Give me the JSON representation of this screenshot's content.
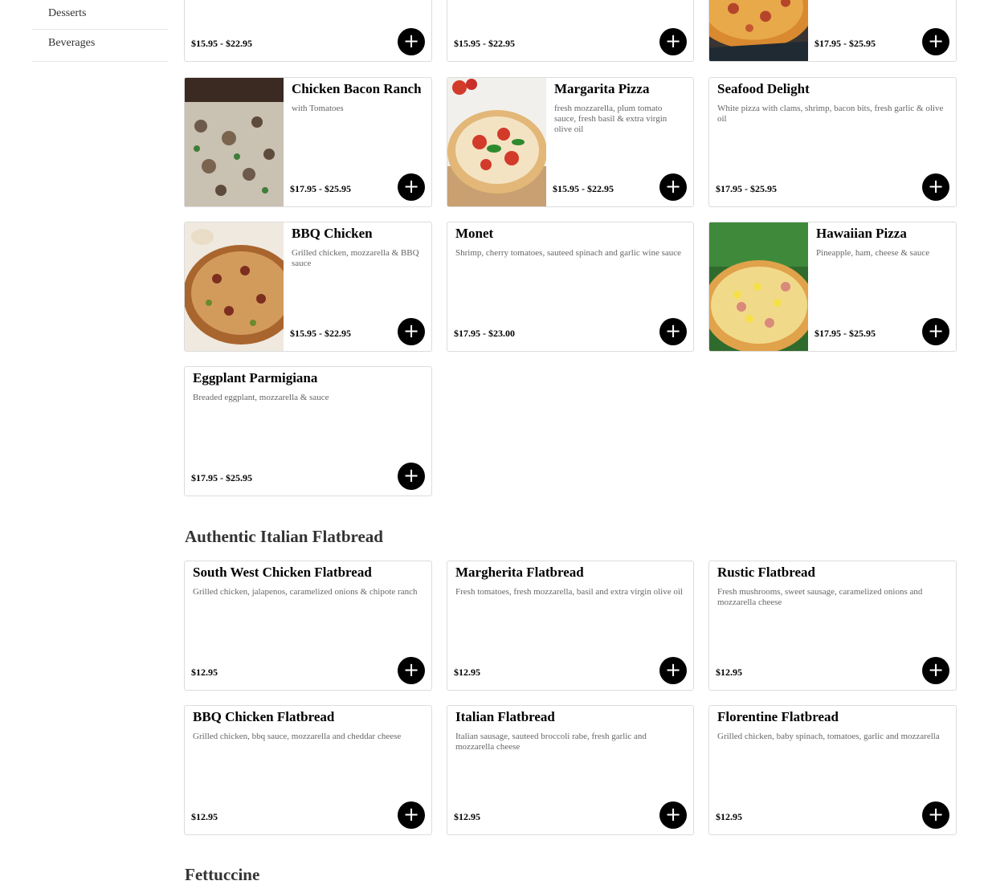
{
  "sidebar": {
    "items": [
      {
        "label": "Desserts"
      },
      {
        "label": "Beverages"
      }
    ]
  },
  "add_icon": "plus-icon",
  "pizza_partial": [
    {
      "price": "$15.95 - $22.95"
    },
    {
      "price": "$15.95 - $22.95"
    },
    {
      "price": "$17.95 - $25.95"
    }
  ],
  "pizza": [
    {
      "title": "Chicken Bacon Ranch",
      "desc": "with Tomatoes",
      "price": "$17.95 - $25.95"
    },
    {
      "title": "Margarita Pizza",
      "desc": "fresh mozzarella, plum tomato sauce, fresh basil & extra virgin olive oil",
      "price": "$15.95 - $22.95"
    },
    {
      "title": "Seafood Delight",
      "desc": "White pizza with clams, shrimp, bacon bits, fresh garlic & olive oil",
      "price": "$17.95 - $25.95"
    },
    {
      "title": "BBQ Chicken",
      "desc": "Grilled chicken, mozzarella & BBQ sauce",
      "price": "$15.95 - $22.95"
    },
    {
      "title": "Monet",
      "desc": "Shrimp, cherry tomatoes, sauteed spinach and garlic wine sauce",
      "price": "$17.95 - $23.00"
    },
    {
      "title": "Hawaiian Pizza",
      "desc": "Pineapple, ham, cheese & sauce",
      "price": "$17.95 - $25.95"
    },
    {
      "title": "Eggplant Parmigiana",
      "desc": "Breaded eggplant, mozzarella & sauce",
      "price": "$17.95 - $25.95"
    }
  ],
  "flatbread": {
    "heading": "Authentic Italian Flatbread",
    "items": [
      {
        "title": "South West Chicken Flatbread",
        "desc": "Grilled chicken, jalapenos, caramelized onions & chipote ranch",
        "price": "$12.95"
      },
      {
        "title": "Margherita Flatbread",
        "desc": "Fresh tomatoes, fresh mozzarella, basil and extra virgin olive oil",
        "price": "$12.95"
      },
      {
        "title": "Rustic Flatbread",
        "desc": "Fresh mushrooms, sweet sausage, caramelized onions and mozzarella cheese",
        "price": "$12.95"
      },
      {
        "title": "BBQ Chicken Flatbread",
        "desc": "Grilled chicken, bbq sauce, mozzarella and cheddar cheese",
        "price": "$12.95"
      },
      {
        "title": "Italian Flatbread",
        "desc": "Italian sausage, sauteed broccoli rabe, fresh garlic and mozzarella cheese",
        "price": "$12.95"
      },
      {
        "title": "Florentine Flatbread",
        "desc": "Grilled chicken, baby spinach, tomatoes, garlic and mozzarella",
        "price": "$12.95"
      }
    ]
  },
  "fettuccine": {
    "heading": "Fettuccine"
  }
}
